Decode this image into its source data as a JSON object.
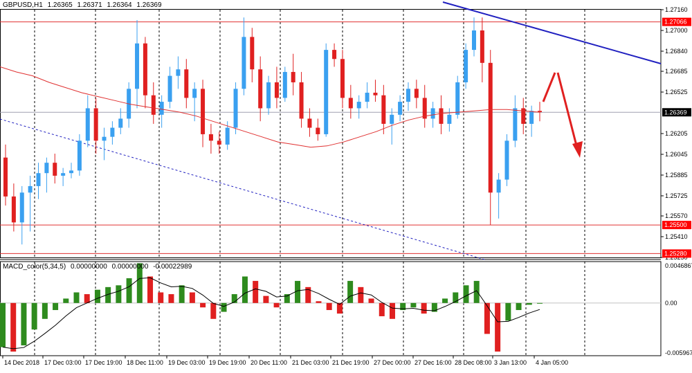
{
  "header": {
    "symbol": "GBPUSD,H1",
    "open": "1.26365",
    "high": "1.26371",
    "low": "1.26364",
    "close": "1.26369"
  },
  "macd_header": {
    "name": "MACD_color(5,34,5)",
    "v1": "0.00000000",
    "v2": "0.00000000",
    "v3": "-0.00022989"
  },
  "price_axis": {
    "ticks": [
      "1.27160",
      "1.27000",
      "1.26840",
      "1.26685",
      "1.26525",
      "1.26205",
      "1.26045",
      "1.25885",
      "1.25725",
      "1.25570",
      "1.25410",
      "1.25250"
    ],
    "current_price_label": "1.26369",
    "resistance_label": "1.27066",
    "support_label": "1.25500",
    "low_support_label": "1.25280"
  },
  "macd_axis": {
    "ticks": [
      "0.0046867",
      "0.00",
      "-0.0059679"
    ]
  },
  "time_axis": {
    "labels": [
      "14 Dec 2018",
      "17 Dec 03:00",
      "17 Dec 19:00",
      "18 Dec 11:00",
      "19 Dec 03:00",
      "19 Dec 19:00",
      "20 Dec 11:00",
      "21 Dec 03:00",
      "21 Dec 19:00",
      "27 Dec 00:00",
      "27 Dec 16:00",
      "28 Dec 08:00",
      "3 Jan 13:00",
      "4 Jan 05:00"
    ]
  },
  "colors": {
    "bull_candle": "#3aa0f0",
    "bear_candle": "#e02020",
    "ma_line": "#e03030",
    "trend_line": "#2020c0",
    "hline": "#e03030",
    "current_line": "#a0a0b0",
    "macd_up": "#2e8b1e",
    "macd_down": "#e02020",
    "signal_line": "#000000",
    "label_red_bg": "#ff0000"
  },
  "chart_data": {
    "type": "candlestick",
    "symbol": "GBPUSD",
    "timeframe": "H1",
    "ylim": [
      1.2525,
      1.2716
    ],
    "levels": [
      1.27066,
      1.255,
      1.2528
    ],
    "current_price": 1.26369,
    "ohlc": [
      [
        1.2602,
        1.2612,
        1.2565,
        1.2572
      ],
      [
        1.2572,
        1.2582,
        1.2545,
        1.2552
      ],
      [
        1.2552,
        1.258,
        1.2535,
        1.2575
      ],
      [
        1.2575,
        1.2588,
        1.2545,
        1.258
      ],
      [
        1.258,
        1.2598,
        1.257,
        1.259
      ],
      [
        1.259,
        1.2602,
        1.2575,
        1.2598
      ],
      [
        1.2598,
        1.2605,
        1.2582,
        1.2588
      ],
      [
        1.2588,
        1.2594,
        1.258,
        1.259
      ],
      [
        1.259,
        1.2598,
        1.2586,
        1.2592
      ],
      [
        1.2592,
        1.262,
        1.2588,
        1.2615
      ],
      [
        1.2615,
        1.265,
        1.261,
        1.264
      ],
      [
        1.264,
        1.2648,
        1.2605,
        1.2615
      ],
      [
        1.2615,
        1.2625,
        1.26,
        1.2618
      ],
      [
        1.2618,
        1.263,
        1.2612,
        1.2625
      ],
      [
        1.2625,
        1.264,
        1.262,
        1.2632
      ],
      [
        1.2632,
        1.266,
        1.2625,
        1.2655
      ],
      [
        1.2655,
        1.2708,
        1.264,
        1.269
      ],
      [
        1.269,
        1.2695,
        1.264,
        1.265
      ],
      [
        1.265,
        1.266,
        1.2628,
        1.2635
      ],
      [
        1.2635,
        1.265,
        1.2625,
        1.2645
      ],
      [
        1.2645,
        1.2672,
        1.264,
        1.2665
      ],
      [
        1.2665,
        1.268,
        1.2655,
        1.267
      ],
      [
        1.267,
        1.2678,
        1.264,
        1.2648
      ],
      [
        1.2648,
        1.266,
        1.263,
        1.2655
      ],
      [
        1.2655,
        1.2662,
        1.261,
        1.262
      ],
      [
        1.262,
        1.2628,
        1.2605,
        1.2615
      ],
      [
        1.2615,
        1.2622,
        1.2605,
        1.2612
      ],
      [
        1.2612,
        1.263,
        1.2608,
        1.2625
      ],
      [
        1.2625,
        1.266,
        1.262,
        1.2655
      ],
      [
        1.2655,
        1.271,
        1.265,
        1.2695
      ],
      [
        1.2695,
        1.2702,
        1.266,
        1.267
      ],
      [
        1.267,
        1.268,
        1.263,
        1.264
      ],
      [
        1.264,
        1.2665,
        1.2635,
        1.266
      ],
      [
        1.266,
        1.2672,
        1.264,
        1.2648
      ],
      [
        1.2648,
        1.2672,
        1.2645,
        1.2668
      ],
      [
        1.2668,
        1.2682,
        1.265,
        1.266
      ],
      [
        1.266,
        1.2668,
        1.2625,
        1.2632
      ],
      [
        1.2632,
        1.264,
        1.2618,
        1.2625
      ],
      [
        1.2625,
        1.2632,
        1.2615,
        1.262
      ],
      [
        1.262,
        1.269,
        1.2618,
        1.2685
      ],
      [
        1.2685,
        1.269,
        1.2672,
        1.2678
      ],
      [
        1.2678,
        1.2685,
        1.264,
        1.2648
      ],
      [
        1.2648,
        1.2658,
        1.2632,
        1.264
      ],
      [
        1.264,
        1.265,
        1.2632,
        1.2645
      ],
      [
        1.2645,
        1.266,
        1.264,
        1.2652
      ],
      [
        1.2652,
        1.2662,
        1.2645,
        1.265
      ],
      [
        1.265,
        1.2658,
        1.262,
        1.2628
      ],
      [
        1.2628,
        1.264,
        1.2612,
        1.2635
      ],
      [
        1.2635,
        1.265,
        1.263,
        1.2645
      ],
      [
        1.2645,
        1.266,
        1.2638,
        1.2655
      ],
      [
        1.2655,
        1.2662,
        1.264,
        1.2648
      ],
      [
        1.2648,
        1.2658,
        1.2625,
        1.2632
      ],
      [
        1.2632,
        1.2645,
        1.2625,
        1.264
      ],
      [
        1.264,
        1.265,
        1.262,
        1.2628
      ],
      [
        1.2628,
        1.264,
        1.2622,
        1.2635
      ],
      [
        1.2635,
        1.2665,
        1.2632,
        1.266
      ],
      [
        1.266,
        1.269,
        1.2655,
        1.2685
      ],
      [
        1.2685,
        1.271,
        1.268,
        1.27
      ],
      [
        1.27,
        1.271,
        1.266,
        1.2675
      ],
      [
        1.2675,
        1.2685,
        1.255,
        1.2575
      ],
      [
        1.2575,
        1.259,
        1.2555,
        1.2585
      ],
      [
        1.2585,
        1.262,
        1.258,
        1.2615
      ],
      [
        1.2615,
        1.265,
        1.261,
        1.264
      ],
      [
        1.264,
        1.2648,
        1.262,
        1.2628
      ],
      [
        1.2628,
        1.2642,
        1.2618,
        1.2638
      ],
      [
        1.2638,
        1.2645,
        1.263,
        1.2637
      ]
    ],
    "ma": [
      1.2672,
      1.2668,
      1.2665,
      1.266,
      1.2656,
      1.2652,
      1.2649,
      1.2646,
      1.2643,
      1.2641,
      1.2639,
      1.2637,
      1.2634,
      1.263,
      1.2626,
      1.2622,
      1.2618,
      1.2614,
      1.2612,
      1.261,
      1.2611,
      1.2614,
      1.2618,
      1.2622,
      1.2627,
      1.2631,
      1.2634,
      1.2636,
      1.2637,
      1.2638,
      1.2639,
      1.2639,
      1.2638,
      1.2637
    ],
    "macd": [
      -0.005,
      -0.0055,
      -0.0048,
      -0.003,
      -0.0018,
      -0.0008,
      0.0005,
      0.0012,
      0.001,
      0.0015,
      0.0018,
      0.002,
      0.0028,
      0.0045,
      0.003,
      0.0012,
      0.001,
      0.002,
      0.0012,
      -0.0005,
      -0.0018,
      -0.001,
      0.001,
      0.003,
      0.0025,
      0.0008,
      -0.0005,
      0.001,
      0.0025,
      0.0018,
      0.0002,
      -0.0008,
      -0.0012,
      0.0025,
      0.0018,
      0.0005,
      -0.0015,
      -0.0018,
      -0.0008,
      -0.0005,
      -0.0012,
      -0.001,
      0.0005,
      0.0012,
      0.002,
      0.0025,
      -0.0035,
      -0.0055,
      -0.002,
      -0.0008,
      -0.0002,
      0.0
    ],
    "macd_ylim": [
      -0.0059679,
      0.0046867
    ]
  }
}
